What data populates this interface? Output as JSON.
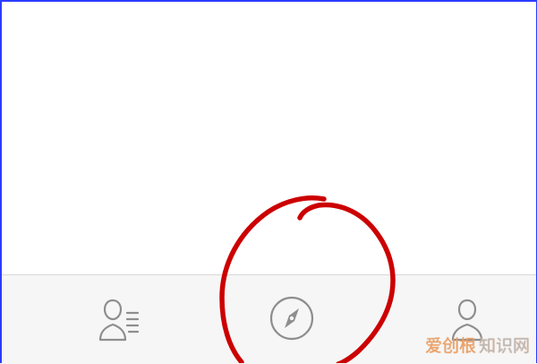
{
  "tabbar": {
    "tabs": [
      {
        "label": "",
        "icon": "contacts-icon"
      },
      {
        "label": "",
        "icon": "compass-icon"
      },
      {
        "label": "",
        "icon": "user-icon"
      }
    ],
    "icon_color": "#8e8e8e"
  },
  "annotation": {
    "shape": "hand-drawn circle",
    "color": "#cc0000"
  },
  "watermark": {
    "brand": "爱创根",
    "site": "知识网"
  }
}
